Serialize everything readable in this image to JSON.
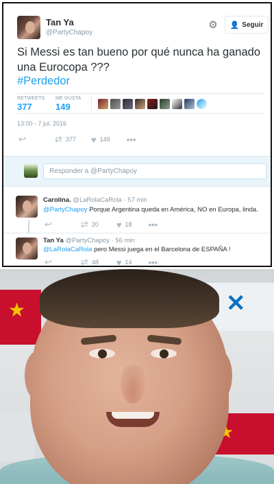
{
  "tweet": {
    "name": "Tan Ya",
    "handle": "@PartyChapoy",
    "follow_label": "Seguir",
    "text": "Si Messi es tan bueno por qué nunca ha ganado una Eurocopa ???",
    "hashtag": "#Perdedor",
    "retweets_label": "RETWEETS",
    "retweets": "377",
    "likes_label": "ME GUSTA",
    "likes": "149",
    "timestamp": "13:00 - 7 jul. 2016",
    "action_retweets": "377",
    "action_likes": "149"
  },
  "reply_box": {
    "placeholder_prefix": "Responder a ",
    "placeholder_mention": "@PartyChapoy"
  },
  "replies": [
    {
      "name": "Carolina.",
      "meta": "@LaRolaCaRola · 57 min",
      "mention": "@PartyChapoy",
      "text": " Porque Argentina queda en América, NO en Europa, linda.",
      "retweets": "20",
      "likes": "18"
    },
    {
      "name": "Tan Ya",
      "meta": "@PartyChapoy · 56 min",
      "mention": "@LaRolaCaRola",
      "text": " pero Messi juega en el Barcelona de ESPAÑA !",
      "retweets": "48",
      "likes": "14"
    }
  ],
  "icons": {
    "gear": "gear-icon",
    "follow": "add-user-icon",
    "reply": "reply-arrow-icon",
    "retweet": "retweet-icon",
    "like": "heart-icon",
    "more": "more-dots-icon"
  },
  "colors": {
    "accent": "#1da1f2",
    "muted": "#8899a6",
    "reply_bar": "#e9f4fb"
  }
}
